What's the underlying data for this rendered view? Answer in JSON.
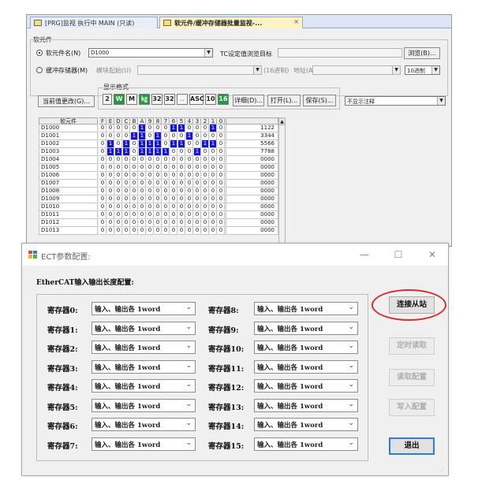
{
  "colors": {
    "bit_on": "#1414d6",
    "accent_green": "#1f9d3a",
    "highlight_circle": "#d22f2f",
    "default_button_border": "#2f7bd8"
  },
  "monitor": {
    "tabs": [
      {
        "label": "[PRG]监视 执行中 MAIN (只读)",
        "icon": "program-icon"
      },
      {
        "label": "软元件/缓冲存储器批量监视-...",
        "icon": "monitor-icon",
        "close": "×"
      }
    ],
    "device_group_label": "软元件",
    "device_name_label": "软元件名(N)",
    "device_name_value": "D1000",
    "tc_label": "TC设定值浏览目标",
    "browse_button": "浏览(B)...",
    "buffer_label": "缓冲存储器(M)",
    "module_start_label": "模块起始(U)",
    "hex_label": "(16进制)",
    "address_label": "地址(A)",
    "radix_value": "10进制",
    "display_format_label": "显示格式",
    "change_value_button": "当前值更改(G)...",
    "format_buttons": [
      "2",
      "W",
      "M",
      "㎏",
      "32",
      "32",
      "..",
      "ASC",
      "10",
      "16"
    ],
    "detail_button": "详细(D)...",
    "open_button": "打开(L)...",
    "save_button": "保存(S)...",
    "comment_select": "不显示注释",
    "grid_header_name": "软元件",
    "bit_headers": [
      "F",
      "E",
      "D",
      "C",
      "B",
      "A",
      "9",
      "8",
      "7",
      "6",
      "5",
      "4",
      "3",
      "2",
      "1",
      "0"
    ],
    "rows": [
      {
        "name": "D1000",
        "bits": "0000010001100010",
        "value": "1122"
      },
      {
        "name": "D1001",
        "bits": "0000110100010000",
        "value": "3344"
      },
      {
        "name": "D1002",
        "bits": "0101011101100110",
        "value": "5566"
      },
      {
        "name": "D1003",
        "bits": "0111011110001000",
        "value": "7788"
      },
      {
        "name": "D1004",
        "bits": "0000000000000000",
        "value": "0000"
      },
      {
        "name": "D1005",
        "bits": "0000000000000000",
        "value": "0000"
      },
      {
        "name": "D1006",
        "bits": "0000000000000000",
        "value": "0000"
      },
      {
        "name": "D1007",
        "bits": "0000000000000000",
        "value": "0000"
      },
      {
        "name": "D1008",
        "bits": "0000000000000000",
        "value": "0000"
      },
      {
        "name": "D1009",
        "bits": "0000000000000000",
        "value": "0000"
      },
      {
        "name": "D1010",
        "bits": "0000000000000000",
        "value": "0000"
      },
      {
        "name": "D1011",
        "bits": "0000000000000000",
        "value": "0000"
      },
      {
        "name": "D1012",
        "bits": "0000000000000000",
        "value": "0000"
      },
      {
        "name": "D1013",
        "bits": "0000000000000000",
        "value": "0000"
      }
    ]
  },
  "dialog": {
    "title": "ECT参数配置:",
    "window_controls": {
      "minimize": "—",
      "maximize": "☐",
      "close": "✕"
    },
    "heading": "EtherCAT输入输出长度配置:",
    "registers": [
      {
        "label": "寄存器0:",
        "value": "输入、输出各 1word"
      },
      {
        "label": "寄存器1:",
        "value": "输入、输出各 1word"
      },
      {
        "label": "寄存器2:",
        "value": "输入、输出各 1word"
      },
      {
        "label": "寄存器3:",
        "value": "输入、输出各 1word"
      },
      {
        "label": "寄存器4:",
        "value": "输入、输出各 1word"
      },
      {
        "label": "寄存器5:",
        "value": "输入、输出各 1word"
      },
      {
        "label": "寄存器6:",
        "value": "输入、输出各 1word"
      },
      {
        "label": "寄存器7:",
        "value": "输入、输出各 1word"
      },
      {
        "label": "寄存器8:",
        "value": "输入、输出各 1word"
      },
      {
        "label": "寄存器9:",
        "value": "输入、输出各 1word"
      },
      {
        "label": "寄存器10:",
        "value": "输入、输出各 1word"
      },
      {
        "label": "寄存器11:",
        "value": "输入、输出各 1word"
      },
      {
        "label": "寄存器12:",
        "value": "输入、输出各 1word"
      },
      {
        "label": "寄存器13:",
        "value": "输入、输出各 1word"
      },
      {
        "label": "寄存器14:",
        "value": "输入、输出各 1word"
      },
      {
        "label": "寄存器15:",
        "value": "输入、输出各 1word"
      }
    ],
    "buttons": {
      "connect": "连接从站",
      "timed_read": "定时读取",
      "read_config": "读取配置",
      "write_config": "写入配置",
      "exit": "退出"
    }
  }
}
